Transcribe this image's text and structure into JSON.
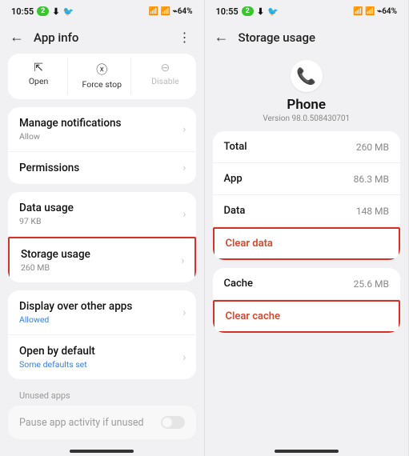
{
  "status": {
    "time": "10:55",
    "badge": "2",
    "down_icon": "⬇",
    "tw_icon": "🐦",
    "right": "📶 📶 ⌁64%"
  },
  "left_screen": {
    "title": "App info",
    "actions": {
      "open": "Open",
      "force_stop": "Force stop",
      "disable": "Disable"
    },
    "items": {
      "manage_notifications": {
        "label": "Manage notifications",
        "sub": "Allow"
      },
      "permissions": {
        "label": "Permissions"
      },
      "data_usage": {
        "label": "Data usage",
        "sub": "97 KB"
      },
      "storage_usage": {
        "label": "Storage usage",
        "sub": "260 MB"
      },
      "display_over": {
        "label": "Display over other apps",
        "sub": "Allowed"
      },
      "open_default": {
        "label": "Open by default",
        "sub": "Some defaults set"
      }
    },
    "unused_label": "Unused apps",
    "pause_label": "Pause app activity if unused"
  },
  "right_screen": {
    "title": "Storage usage",
    "app_name": "Phone",
    "version": "Version 98.0.508430701",
    "rows": {
      "total": {
        "k": "Total",
        "v": "260 MB"
      },
      "app": {
        "k": "App",
        "v": "86.3 MB"
      },
      "data": {
        "k": "Data",
        "v": "148 MB"
      },
      "cache": {
        "k": "Cache",
        "v": "25.6 MB"
      }
    },
    "clear_data": "Clear data",
    "clear_cache": "Clear cache"
  }
}
